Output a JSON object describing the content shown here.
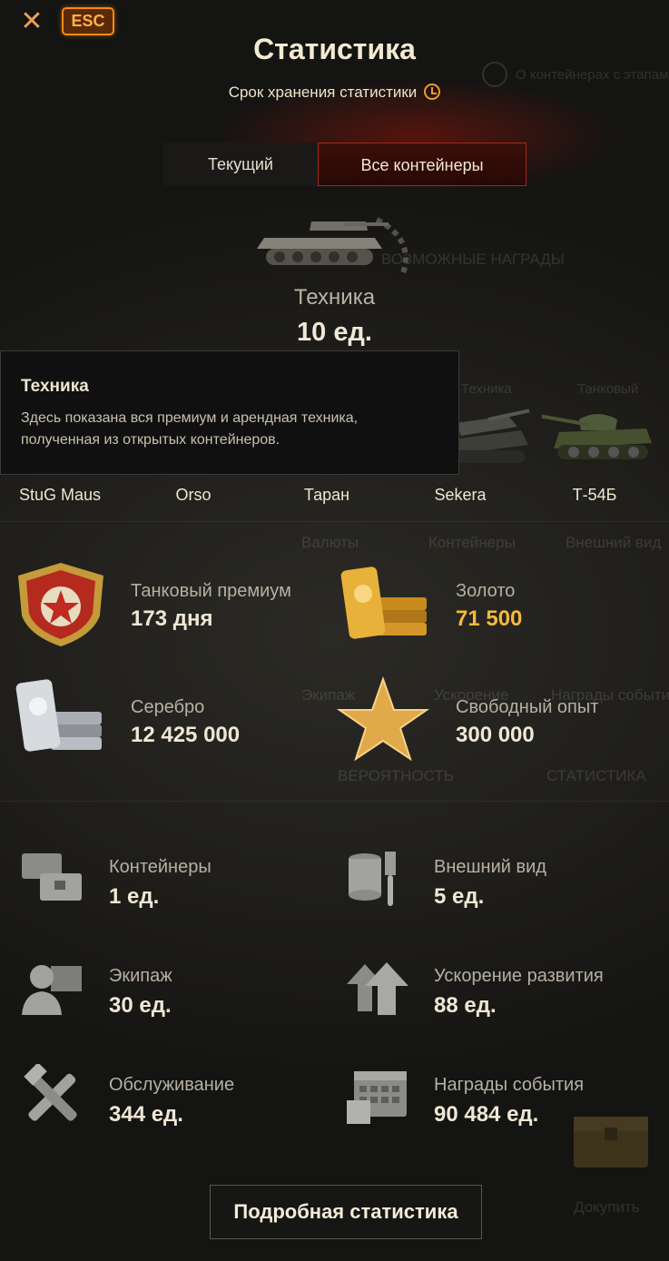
{
  "header": {
    "close_icon": "close-icon",
    "esc_label": "ESC",
    "title": "Статистика",
    "retention_label": "Срок хранения статистики"
  },
  "tabs": [
    {
      "label": "Текущий",
      "active": false
    },
    {
      "label": "Все контейнеры",
      "active": true
    }
  ],
  "background_ghost": {
    "info": "О контейнерах с этапам",
    "rewards": "ВОЗМОЖНЫЕ НАГРАДЫ",
    "tech": "Техника",
    "tank_prem": "Танковый",
    "currency": "Валюты",
    "containers": "Контейнеры",
    "appearance": "Внешний вид",
    "crew": "Экипаж",
    "accel": "Ускорение",
    "event": "Награды события",
    "probability": "ВЕРОЯТНОСТЬ",
    "statistics": "СТАТИСТИКА",
    "buy": "Докупить"
  },
  "hero": {
    "label": "Техника",
    "value": "10 ед."
  },
  "tooltip": {
    "title": "Техника",
    "body": "Здесь показана вся премиум и арендная техника, полученная из открытых контейнеров."
  },
  "tanks": [
    {
      "name": "StuG Maus"
    },
    {
      "name": "Orso"
    },
    {
      "name": "Таран"
    },
    {
      "name": "Sekera"
    },
    {
      "name": "Т-54Б"
    }
  ],
  "big_rewards": [
    {
      "icon": "premium-tank-icon",
      "label": "Танковый премиум",
      "value": "173 дня"
    },
    {
      "icon": "gold-bars-icon",
      "label": "Золото",
      "value": "71 500"
    },
    {
      "icon": "silver-bars-icon",
      "label": "Серебро",
      "value": "12 425 000"
    },
    {
      "icon": "star-icon",
      "label": "Свободный опыт",
      "value": "300 000"
    }
  ],
  "small_rewards": [
    {
      "icon": "containers-icon",
      "label": "Контейнеры",
      "value": "1 ед."
    },
    {
      "icon": "paint-brush-icon",
      "label": "Внешний вид",
      "value": "5 ед."
    },
    {
      "icon": "crew-icon",
      "label": "Экипаж",
      "value": "30 ед."
    },
    {
      "icon": "arrows-up-icon",
      "label": "Ускорение развития",
      "value": "88 ед."
    },
    {
      "icon": "tools-icon",
      "label": "Обслуживание",
      "value": "344 ед."
    },
    {
      "icon": "calendar-icon",
      "label": "Награды события",
      "value": "90 484 ед."
    }
  ],
  "footer": {
    "detail_button": "Подробная статистика"
  },
  "colors": {
    "accent_orange": "#f08a1a",
    "gold_value": "#f6b93d",
    "tab_active_border": "#a6271a"
  }
}
